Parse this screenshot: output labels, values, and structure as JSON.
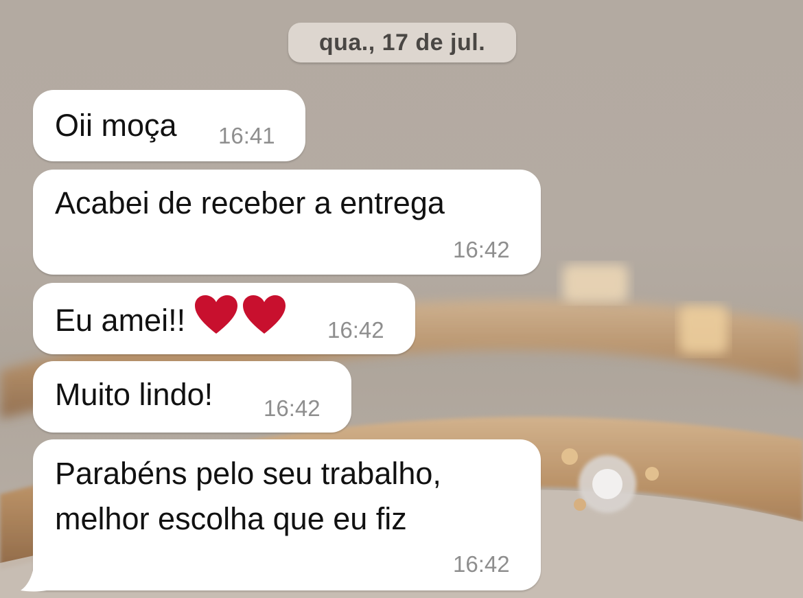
{
  "chat": {
    "date_label": "qua., 17 de jul.",
    "messages": [
      {
        "text": "Oii moça",
        "time": "16:41"
      },
      {
        "text": "Acabei de receber a entrega",
        "time": "16:42"
      },
      {
        "text": "Eu amei!!",
        "emoji": "heart-icon x2",
        "time": "16:42"
      },
      {
        "text": "Muito lindo!",
        "time": "16:42"
      },
      {
        "lines": [
          "Parabéns pelo seu trabalho,",
          "melhor escolha que eu fiz"
        ],
        "time": "16:42"
      }
    ]
  },
  "colors": {
    "bubble": "#ffffff",
    "date_chip": "#ddd6cf",
    "time_text": "#8e8e8e",
    "heart": "#c8102e"
  }
}
